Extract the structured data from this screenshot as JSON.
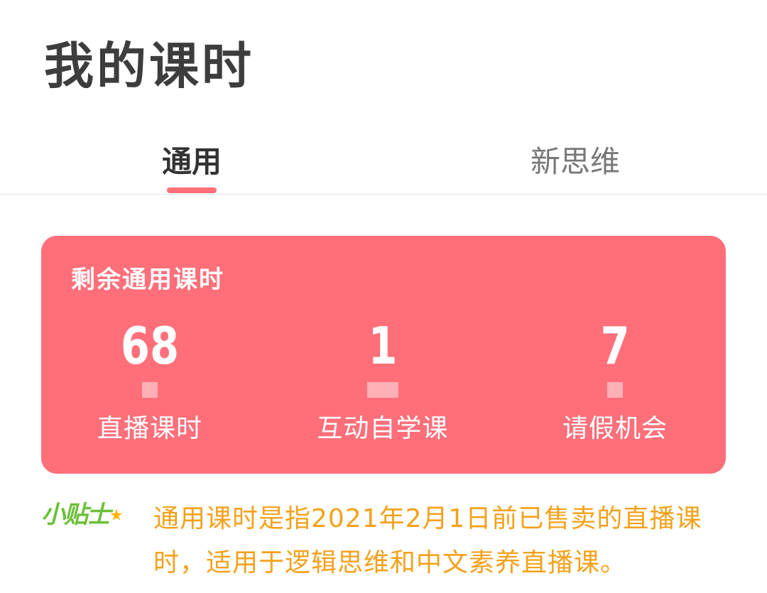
{
  "header": {
    "title": "我的课时"
  },
  "tabs": [
    {
      "label": "通用",
      "active": true
    },
    {
      "label": "新思维",
      "active": false
    }
  ],
  "card": {
    "title": "剩余通用课时",
    "stats": [
      {
        "value": "68",
        "label": "直播课时"
      },
      {
        "value": "1",
        "label": "互动自学课"
      },
      {
        "value": "7",
        "label": "请假机会"
      }
    ]
  },
  "tip": {
    "badge": "小贴士",
    "badge_icon": "star-icon",
    "text": "通用课时是指2021年2月1日前已售卖的直播课时，适用于逻辑思维和中文素养直播课。"
  },
  "colors": {
    "accent": "#ff6f7a",
    "tip_text": "#f5a11b",
    "tip_badge": "#6cc03a",
    "title": "#3d3d3d"
  }
}
